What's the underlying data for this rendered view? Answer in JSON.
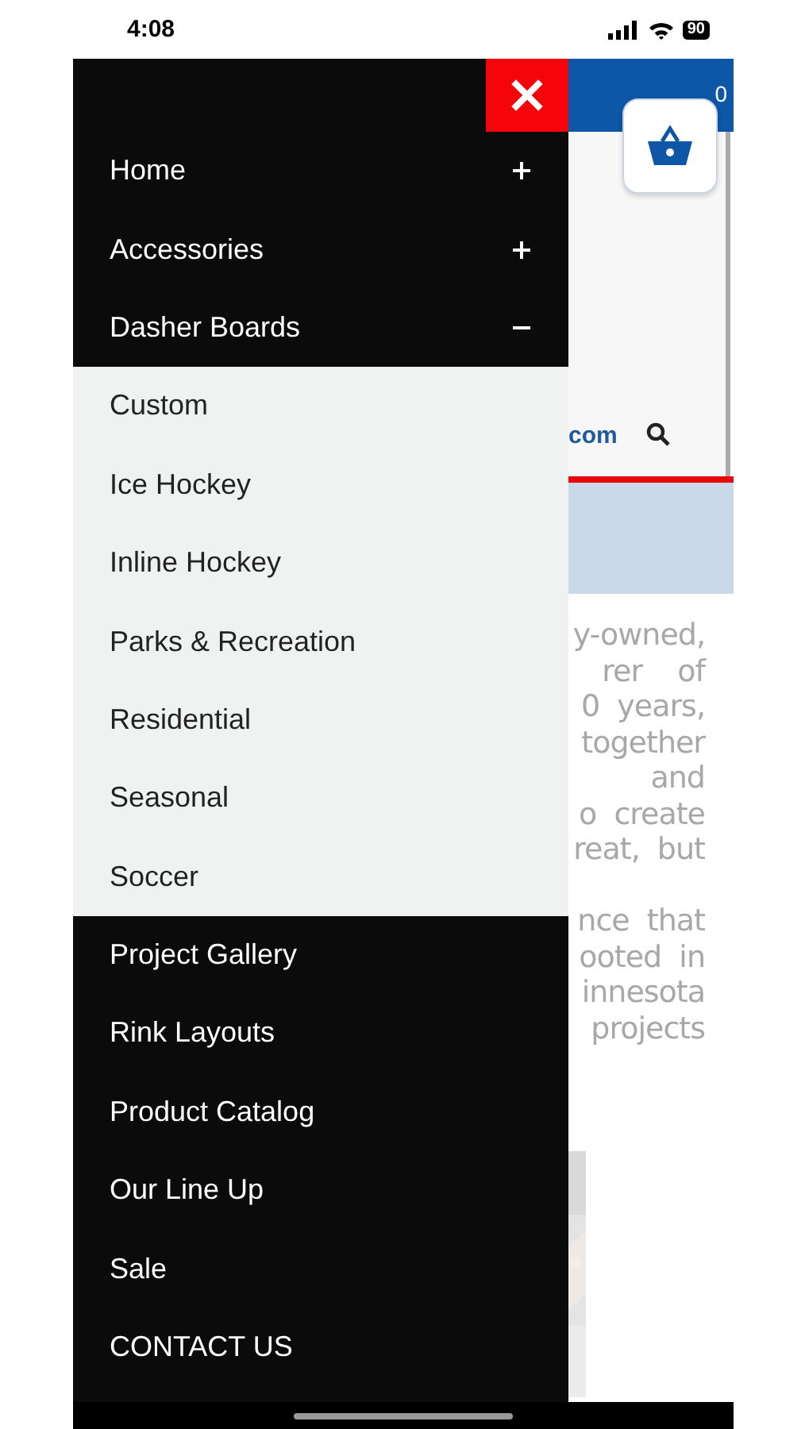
{
  "status_bar": {
    "time": "4:08",
    "battery": "90"
  },
  "menu": {
    "items": [
      {
        "label": "Home",
        "kind": "expandable",
        "expanded": false
      },
      {
        "label": "Accessories",
        "kind": "expandable",
        "expanded": false
      },
      {
        "label": "Dasher Boards",
        "kind": "expandable",
        "expanded": true,
        "children": [
          {
            "label": "Custom"
          },
          {
            "label": "Ice Hockey"
          },
          {
            "label": "Inline Hockey"
          },
          {
            "label": "Parks & Recreation"
          },
          {
            "label": "Residential"
          },
          {
            "label": "Seasonal"
          },
          {
            "label": "Soccer"
          }
        ]
      },
      {
        "label": "Project Gallery",
        "kind": "link"
      },
      {
        "label": "Rink Layouts",
        "kind": "link"
      },
      {
        "label": "Product Catalog",
        "kind": "link"
      },
      {
        "label": "Our Line Up",
        "kind": "link"
      },
      {
        "label": "Sale",
        "kind": "link"
      },
      {
        "label": "CONTACT US",
        "kind": "link"
      }
    ]
  },
  "page": {
    "cart_count": "0",
    "site_text": "com",
    "body_paragraphs": [
      [
        "y-owned,",
        "rer    of",
        "0  years,",
        "together",
        "and",
        "o  create",
        "reat,  but"
      ],
      [
        "nce  that",
        "ooted  in",
        "innesota",
        "projects"
      ]
    ]
  }
}
